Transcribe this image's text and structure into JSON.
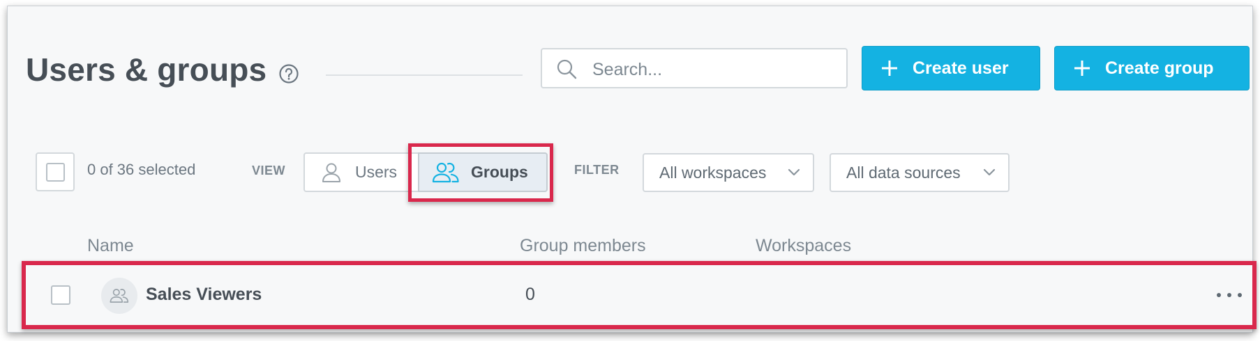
{
  "header": {
    "title": "Users & groups",
    "help_icon": "help-circle-icon",
    "search": {
      "placeholder": "Search...",
      "value": "",
      "icon": "search-icon"
    },
    "create_user_label": "Create user",
    "create_group_label": "Create group",
    "button_color": "#14b2e2"
  },
  "toolbar": {
    "selected_text": "0 of 36 selected",
    "view_label": "VIEW",
    "view_options": [
      {
        "label": "Users",
        "icon": "user-icon",
        "active": false
      },
      {
        "label": "Groups",
        "icon": "users-group-icon",
        "active": true
      }
    ],
    "filter_label": "FILTER",
    "filters": [
      {
        "label": "All workspaces",
        "icon": "chevron-down-icon"
      },
      {
        "label": "All data sources",
        "icon": "chevron-down-icon"
      }
    ]
  },
  "table": {
    "columns": [
      "Name",
      "Group members",
      "Workspaces"
    ],
    "rows": [
      {
        "name": "Sales Viewers",
        "members": "0",
        "workspaces": "",
        "avatar_icon": "users-group-icon",
        "menu_icon": "more-horizontal-icon"
      }
    ]
  },
  "colors": {
    "highlight": "#d9284c",
    "active_segment": "#e7edf3"
  }
}
